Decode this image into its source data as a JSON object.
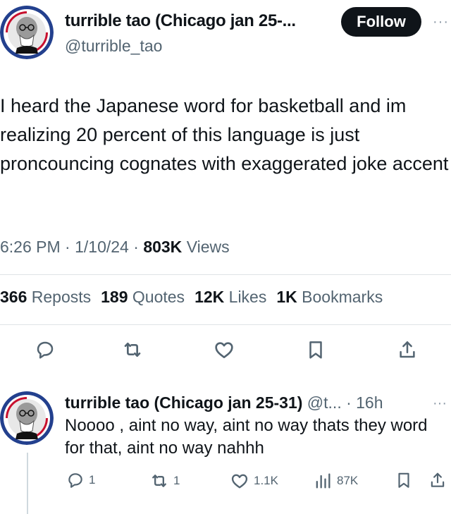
{
  "tweet": {
    "author_name": "turrible tao (Chicago jan 25-...",
    "author_handle": "@turrible_tao",
    "follow_label": "Follow",
    "more": "···",
    "text": "I heard the Japanese word for basketball and im realizing 20 percent of this language is just proncouncing cognates with exaggerated joke accent",
    "time": "6:26 PM",
    "date": "1/10/24",
    "views_count": "803K",
    "views_label": "Views",
    "sep": " · "
  },
  "stats": [
    {
      "count": "366",
      "label": "Reposts"
    },
    {
      "count": "189",
      "label": "Quotes"
    },
    {
      "count": "12K",
      "label": "Likes"
    },
    {
      "count": "1K",
      "label": "Bookmarks"
    }
  ],
  "actions": [
    "reply-icon",
    "repost-icon",
    "like-icon",
    "bookmark-icon",
    "share-icon"
  ],
  "reply": {
    "author_name": "turrible tao (Chicago jan 25-31)",
    "handle_time": " @t... · 16h",
    "more": "···",
    "text": "Noooo , aint no way, aint no way thats they word for that, aint no way nahhh",
    "reply_count": "1",
    "repost_count": "1",
    "like_count": "1.1K",
    "views_count": "87K"
  },
  "colors": {
    "text": "#0f1419",
    "secondary": "#536471",
    "follow_bg": "#0f1419",
    "divider": "#dfe3e6"
  }
}
